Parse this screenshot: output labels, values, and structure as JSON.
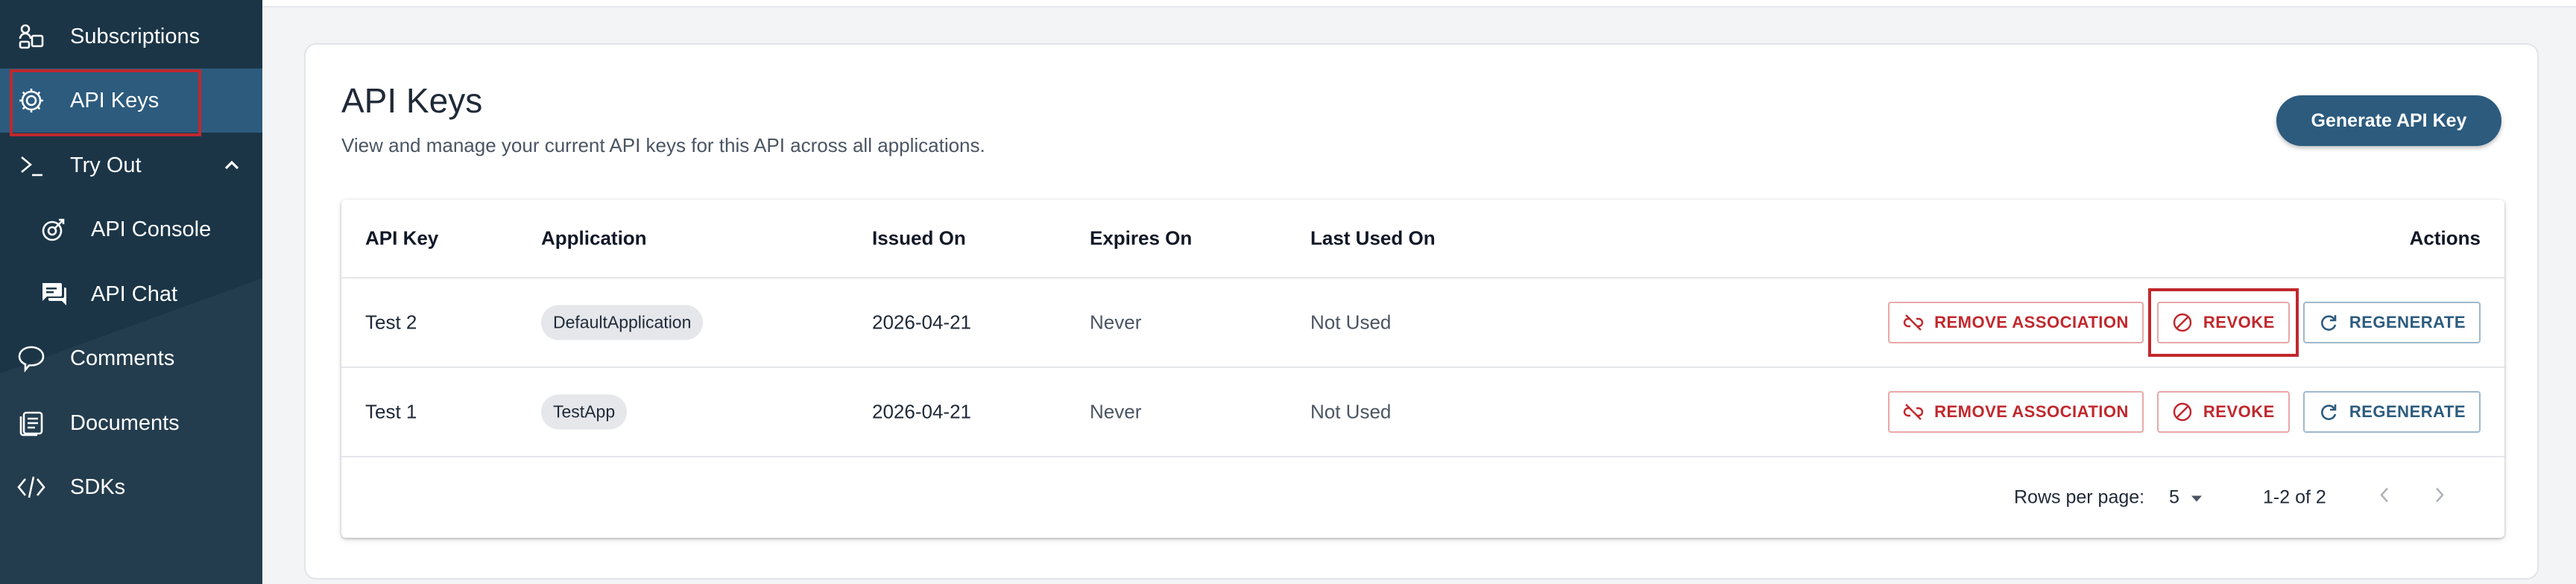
{
  "sidebar": {
    "items": [
      {
        "label": "Subscriptions",
        "icon": "subscriptions-icon"
      },
      {
        "label": "API Keys",
        "icon": "gear-icon",
        "active": true
      },
      {
        "label": "Try Out",
        "icon": "terminal-icon",
        "expanded": true
      },
      {
        "label": "API Console",
        "icon": "console-icon"
      },
      {
        "label": "API Chat",
        "icon": "chat-icon"
      },
      {
        "label": "Comments",
        "icon": "comment-icon"
      },
      {
        "label": "Documents",
        "icon": "documents-icon"
      },
      {
        "label": "SDKs",
        "icon": "code-icon"
      }
    ]
  },
  "main": {
    "title": "API Keys",
    "description": "View and manage your current API keys for this API across all applications.",
    "generate_button": "Generate API Key",
    "table": {
      "headers": {
        "api_key": "API Key",
        "application": "Application",
        "issued_on": "Issued On",
        "expires_on": "Expires On",
        "last_used_on": "Last Used On",
        "actions": "Actions"
      },
      "rows": [
        {
          "api_key": "Test 2",
          "application": "DefaultApplication",
          "issued_on": "2026-04-21",
          "expires_on": "Never",
          "last_used_on": "Not Used"
        },
        {
          "api_key": "Test 1",
          "application": "TestApp",
          "issued_on": "2026-04-21",
          "expires_on": "Never",
          "last_used_on": "Not Used"
        }
      ],
      "action_labels": {
        "remove": "REMOVE ASSOCIATION",
        "revoke": "REVOKE",
        "regenerate": "REGENERATE"
      }
    },
    "pagination": {
      "rows_per_page_label": "Rows per page:",
      "rows_per_page_value": "5",
      "range": "1-2 of 2"
    }
  },
  "colors": {
    "sidebar_bg": "#1b3547",
    "sidebar_active": "#2c5b7e",
    "primary": "#2c5b7e",
    "danger": "#c0282d",
    "highlight": "#c0282d"
  }
}
